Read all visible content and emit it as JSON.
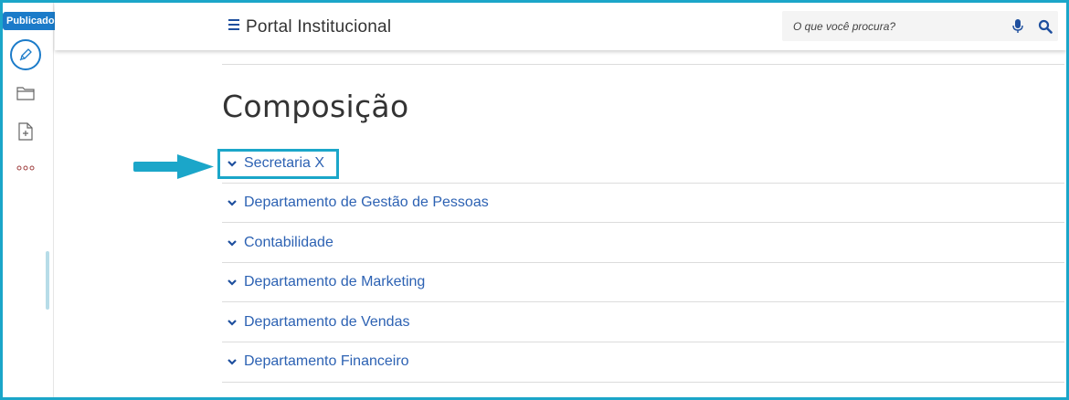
{
  "rail": {
    "status_badge": "Publicado",
    "icons": [
      "pencil-icon",
      "folder-icon",
      "add-file-icon",
      "more-icon"
    ]
  },
  "header": {
    "title": "Portal Institucional",
    "search_placeholder": "O que você procura?"
  },
  "main": {
    "title": "Composição",
    "items": [
      {
        "label": "Secretaria X"
      },
      {
        "label": "Departamento de Gestão de Pessoas"
      },
      {
        "label": "Contabilidade"
      },
      {
        "label": "Departamento de Marketing"
      },
      {
        "label": "Departamento de Vendas"
      },
      {
        "label": "Departamento Financeiro"
      }
    ]
  },
  "colors": {
    "accent": "#1ba6c9",
    "link": "#2d62b3",
    "badge": "#1b7bc9"
  }
}
